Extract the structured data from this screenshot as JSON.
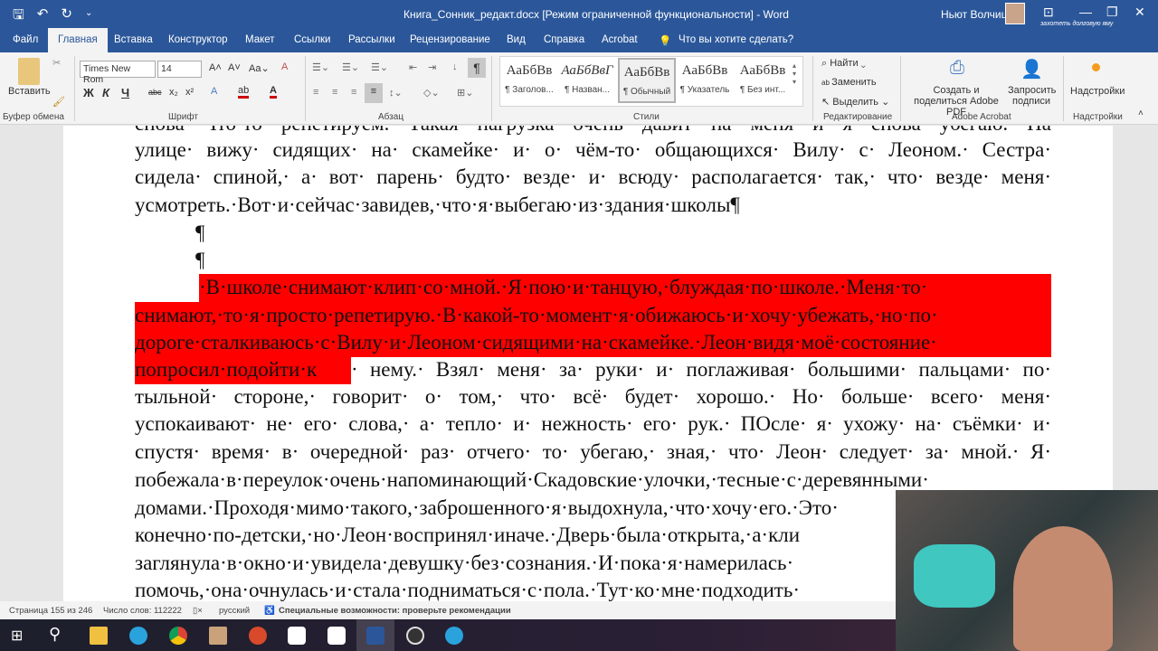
{
  "title_bar": {
    "title": "Книга_Сонник_редакт.docx [Режим ограниченной функциональности]  -  Word",
    "user": "Ньют Волчица",
    "hint": "захотеть долговую яму",
    "search_pct": "%"
  },
  "tabs": [
    "Файл",
    "Главная",
    "Вставка",
    "Конструктор",
    "Макет",
    "Ссылки",
    "Рассылки",
    "Рецензирование",
    "Вид",
    "Справка",
    "Acrobat",
    "Что вы хотите сделать?"
  ],
  "ribbon": {
    "paste": "Вставить",
    "clipboard": "Буфер обмена",
    "font_name": "Times New Rom",
    "font_size": "14",
    "font_group": "Шрифт",
    "bold": "Ж",
    "italic": "К",
    "underline": "Ч",
    "paragraph_group": "Абзац",
    "styles": [
      {
        "sample": "АаБбВв",
        "label": "¶ Заголов..."
      },
      {
        "sample": "АаБбВвГ",
        "label": "¶ Назван..."
      },
      {
        "sample": "АаБбВв",
        "label": "¶ Обычный"
      },
      {
        "sample": "АаБбВв",
        "label": "¶ Указатель"
      },
      {
        "sample": "АаБбВв",
        "label": "¶ Без инт..."
      }
    ],
    "styles_group": "Стили",
    "find": "Найти",
    "replace": "Заменить",
    "select": "Выделить",
    "editing_group": "Редактирование",
    "create_pdf": "Создать и поделиться Adobe PDF",
    "request_sign": "Запросить подписи",
    "acrobat_group": "Adobe Acrobat",
    "addins": "Надстройки",
    "addins_group": "Надстройки"
  },
  "document": {
    "lines": [
      "снова· Что·то· репетируем.· Такая· нагрузка· очень· давит· на· меня· и· я· снова· убегаю.· На",
      "улице· вижу· сидящих· на· скамейке· и· о· чём-то· общающихся· Вилу· с· Леоном.· Сестра·",
      "сидела· спиной,· а· вот· парень· будто· везде· и· всюду· располагается· так,· что· везде· меня·",
      "усмотреть.·Вот·и·сейчас·завидев,·что·я·выбегаю·из·здания·школы¶",
      "¶",
      "¶",
      "·В·школе·снимают·клип·со·мной.·Я·пою·и·танцую,·блуждая·по·школе.·Меня·то·",
      "снимают,·то·я·просто·репетирую.·В·какой-то·момент·я·обижаюсь·и·хочу·убежать,·но·по·",
      "дороге·сталкиваюсь·с·Вилу·и·Леоном·сидящими·на·скамейке.·Леон·видя·моё·состояние·",
      "попросил·подойти·к",
      "· нему.· Взял· меня· за· руки· и· поглаживая· большими· пальцами· по·",
      "тыльной· стороне,· говорит· о· том,· что· всё· будет· хорошо.· Но· больше· всего· меня·",
      "успокаивают· не· его· слова,· а· тепло· и· нежность· его· рук.· ПОсле· я· ухожу· на· съёмки· и·",
      "спустя· время· в· очередной· раз· отчего· то· убегаю,· зная,· что· Леон· следует· за· мной.· Я·",
      "побежала·в·переулок·очень·напоминающий·Скадовские·улочки,·тесные·с·деревянными·",
      "домами.·Проходя·мимо·такого,·заброшенного·я·выдохнула,·что·хочу·его.·Это·",
      "конечно·по-детски,·но·Леон·воспринял·иначе.·Дверь·была·открыта,·а·кли",
      "заглянула·в·окно·и·увидела·девушку·без·сознания.·И·пока·я·намерилась·",
      "помочь,·она·очнулась·и·стала·подниматься·с·пола.·Тут·ко·мне·подходить·"
    ],
    "highlight_color": "#ff0000"
  },
  "status": {
    "page": "Страница 155 из 246",
    "words": "Число слов: 112222",
    "lang": "русский",
    "accessibility": "Специальные возможности: проверьте рекомендации"
  }
}
